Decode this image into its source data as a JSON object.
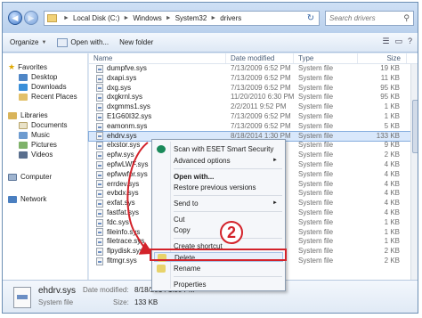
{
  "address": {
    "crumbs": [
      "Local Disk (C:)",
      "Windows",
      "System32",
      "drivers"
    ],
    "search_placeholder": "Search drivers"
  },
  "toolbar": {
    "organize": "Organize",
    "open_with": "Open with...",
    "new_folder": "New folder"
  },
  "nav": {
    "favorites": "Favorites",
    "desktop": "Desktop",
    "downloads": "Downloads",
    "recent": "Recent Places",
    "libraries": "Libraries",
    "documents": "Documents",
    "music": "Music",
    "pictures": "Pictures",
    "videos": "Videos",
    "computer": "Computer",
    "network": "Network"
  },
  "columns": {
    "name": "Name",
    "date": "Date modified",
    "type": "Type",
    "size": "Size"
  },
  "files": [
    {
      "name": "dumpfve.sys",
      "date": "7/13/2009 6:52 PM",
      "type": "System file",
      "size": "19 KB"
    },
    {
      "name": "dxapi.sys",
      "date": "7/13/2009 6:52 PM",
      "type": "System file",
      "size": "11 KB"
    },
    {
      "name": "dxg.sys",
      "date": "7/13/2009 6:52 PM",
      "type": "System file",
      "size": "95 KB"
    },
    {
      "name": "dxgkrnl.sys",
      "date": "11/20/2010 6:30 PM",
      "type": "System file",
      "size": "95 KB"
    },
    {
      "name": "dxgmms1.sys",
      "date": "2/2/2011 9:52 PM",
      "type": "System file",
      "size": "1 KB"
    },
    {
      "name": "E1G60I32.sys",
      "date": "7/13/2009 6:52 PM",
      "type": "System file",
      "size": "1 KB"
    },
    {
      "name": "eamonm.sys",
      "date": "7/13/2009 6:52 PM",
      "type": "System file",
      "size": "5 KB"
    },
    {
      "name": "ehdrv.sys",
      "date": "8/18/2014 1:30 PM",
      "type": "System file",
      "size": "133 KB"
    },
    {
      "name": "elxstor.sys",
      "date": "",
      "type": "System file",
      "size": "9 KB"
    },
    {
      "name": "epfw.sys",
      "date": "",
      "type": "System file",
      "size": "2 KB"
    },
    {
      "name": "epfwLWF.sys",
      "date": "",
      "type": "System file",
      "size": "4 KB"
    },
    {
      "name": "epfwwfpr.sys",
      "date": "",
      "type": "System file",
      "size": "4 KB"
    },
    {
      "name": "errdev.sys",
      "date": "",
      "type": "System file",
      "size": "4 KB"
    },
    {
      "name": "evbdx.sys",
      "date": "",
      "type": "System file",
      "size": "4 KB"
    },
    {
      "name": "exfat.sys",
      "date": "",
      "type": "System file",
      "size": "4 KB"
    },
    {
      "name": "fastfat.sys",
      "date": "",
      "type": "System file",
      "size": "4 KB"
    },
    {
      "name": "fdc.sys",
      "date": "",
      "type": "System file",
      "size": "1 KB"
    },
    {
      "name": "fileinfo.sys",
      "date": "",
      "type": "System file",
      "size": "1 KB"
    },
    {
      "name": "filetrace.sys",
      "date": "",
      "type": "System file",
      "size": "1 KB"
    },
    {
      "name": "flpydisk.sys",
      "date": "",
      "type": "System file",
      "size": "2 KB"
    },
    {
      "name": "fltmgr.sys",
      "date": "",
      "type": "System file",
      "size": "2 KB"
    }
  ],
  "context_menu": {
    "scan": "Scan with ESET Smart Security",
    "advanced": "Advanced options",
    "open_with": "Open with...",
    "restore": "Restore previous versions",
    "send_to": "Send to",
    "cut": "Cut",
    "copy": "Copy",
    "create_shortcut": "Create shortcut",
    "delete": "Delete",
    "rename": "Rename",
    "properties": "Properties"
  },
  "annotation": {
    "step": "2"
  },
  "details": {
    "name": "ehdrv.sys",
    "type": "System file",
    "date_label": "Date modified:",
    "date_value": "8/18/2014 1:30 PM",
    "size_label": "Size:",
    "size_value": "133 KB"
  },
  "colors": {
    "highlight_red": "#d3222a",
    "selection": "#d9e8fb"
  }
}
